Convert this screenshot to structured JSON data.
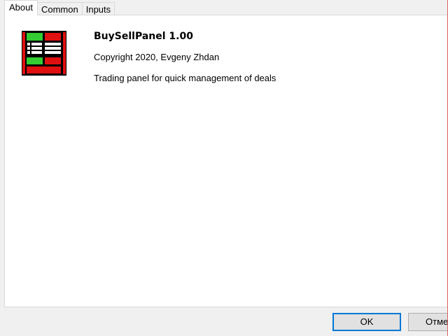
{
  "tabs": [
    {
      "label": "About",
      "active": true
    },
    {
      "label": "Common",
      "active": false
    },
    {
      "label": "Inputs",
      "active": false
    }
  ],
  "about": {
    "title": "BuySellPanel 1.00",
    "copyright": "Copyright 2020, Evgeny Zhdan",
    "description": "Trading panel for quick management of deals"
  },
  "buttons": {
    "ok": "OK",
    "cancel": "Отме"
  },
  "icon": {
    "name": "buysellpanel-app-icon"
  },
  "colors": {
    "accent": "#0078d7",
    "buy_green": "#33cc33",
    "sell_red": "#e01010"
  }
}
